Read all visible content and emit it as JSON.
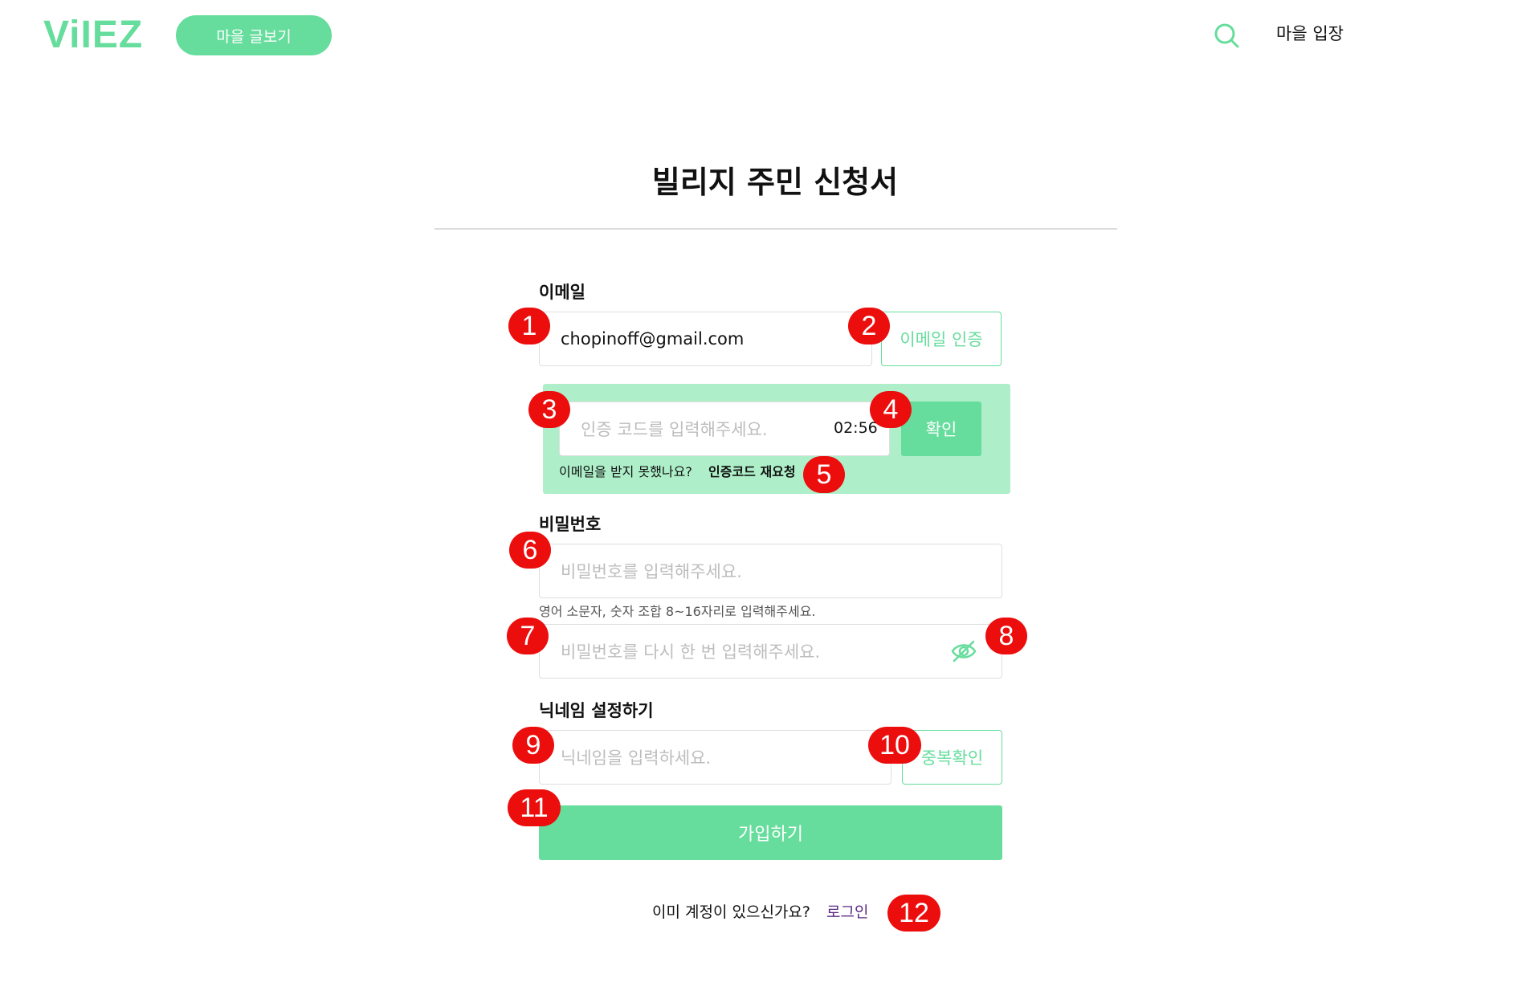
{
  "header": {
    "logo": "ViIEZ",
    "board_button": "마을 글보기",
    "search_icon": "search-icon",
    "enter_link": "마을 입장"
  },
  "title": "빌리지 주민 신청서",
  "email": {
    "label": "이메일",
    "value": "chopinoff@gmail.com",
    "verify_button": "이메일 인증"
  },
  "verification": {
    "placeholder": "인증 코드를 입력해주세요.",
    "timer": "02:56",
    "confirm_button": "확인",
    "not_received": "이메일을 받지 못했나요?",
    "resend_link": "인증코드 재요청"
  },
  "password": {
    "label": "비밀번호",
    "placeholder": "비밀번호를 입력해주세요.",
    "hint": "영어 소문자, 숫자 조합 8~16자리로 입력해주세요.",
    "confirm_placeholder": "비밀번호를 다시 한 번 입력해주세요.",
    "toggle_icon": "eye-off-icon"
  },
  "nickname": {
    "label": "닉네임 설정하기",
    "placeholder": "닉네임을 입력하세요.",
    "check_button": "중복확인"
  },
  "signup_button": "가입하기",
  "footer": {
    "question": "이미 계정이 있으신가요?",
    "login_link": "로그인"
  },
  "markers": [
    "1",
    "2",
    "3",
    "4",
    "5",
    "6",
    "7",
    "8",
    "9",
    "10",
    "11",
    "12"
  ],
  "colors": {
    "accent": "#66dd9c",
    "accent_light": "#aeefc9",
    "marker": "#ec0d0d",
    "link": "#5b2a86"
  }
}
